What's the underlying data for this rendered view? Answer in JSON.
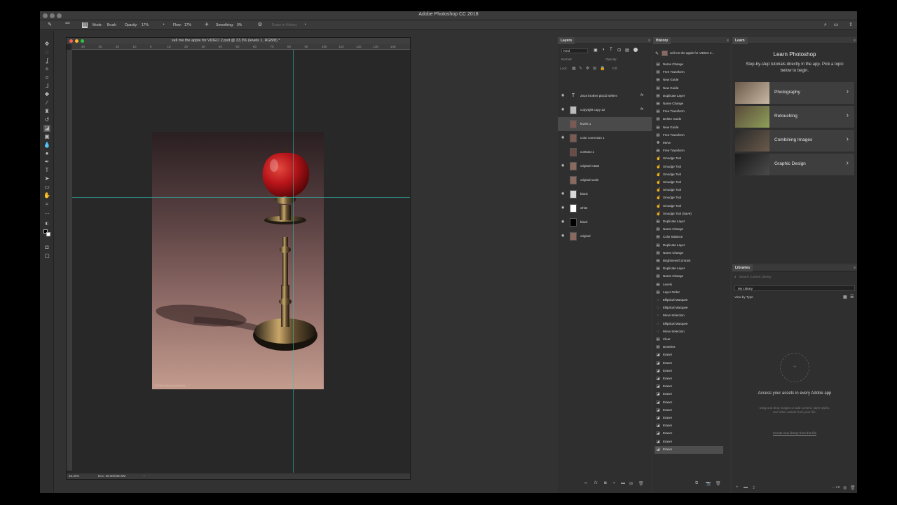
{
  "app": {
    "title": "Adobe Photoshop CC 2018"
  },
  "options_bar": {
    "brush_size": "380",
    "mode_label": "Mode:",
    "mode_value": "Brush",
    "opacity_label": "Opacity:",
    "opacity_value": "17%",
    "flow_label": "Flow:",
    "flow_value": "17%",
    "smoothing_label": "Smoothing:",
    "smoothing_value": "0%",
    "erase_history": "Erase to History"
  },
  "document": {
    "title": "sell me the apple for VIDEO 2.psd @ 33.3% (levels 1, RGB/8) *",
    "ruler_ticks": [
      "40",
      "30",
      "20",
      "10",
      "0",
      "10",
      "20",
      "30",
      "40",
      "50",
      "60",
      "70",
      "80",
      "90",
      "100",
      "110",
      "120",
      "130",
      "140"
    ],
    "zoom": "33.33%",
    "doc_size": "Doc: 39.0M/360.9M",
    "watermark": "©2018 brother placid sellers"
  },
  "layers": {
    "tab": "Layers",
    "filter_kind": "Kind",
    "blend_mode": "Normal",
    "opacity_label": "Opacity:",
    "lock_label": "Lock:",
    "fill_label": "Fill:",
    "items": [
      {
        "name": "2018 brother placid sellers",
        "type": "text",
        "fx": true,
        "visible": true,
        "selected": false,
        "thumb_color": "#2f2f2f"
      },
      {
        "name": "copyright copy 12",
        "type": "pixel",
        "fx": true,
        "visible": true,
        "selected": false,
        "thumb_color": "#bcbcbc"
      },
      {
        "name": "levels 1",
        "type": "pixel",
        "fx": false,
        "visible": false,
        "selected": true,
        "thumb_color": "#7a5a52"
      },
      {
        "name": "color correction 1",
        "type": "pixel",
        "fx": false,
        "visible": true,
        "selected": false,
        "thumb_color": "#7a5a52"
      },
      {
        "name": "contrast 1",
        "type": "pixel",
        "fx": false,
        "visible": false,
        "selected": false,
        "thumb_color": "#6a4c46"
      },
      {
        "name": "original rotate",
        "type": "pixel",
        "fx": false,
        "visible": true,
        "selected": false,
        "thumb_color": "#8a6a5e"
      },
      {
        "name": "original scale",
        "type": "pixel",
        "fx": false,
        "visible": false,
        "selected": false,
        "thumb_color": "#8a6a5e"
      },
      {
        "name": "blank",
        "type": "pixel",
        "fx": false,
        "visible": true,
        "selected": false,
        "thumb_color": "#d8d8d8"
      },
      {
        "name": "white",
        "type": "pixel",
        "fx": false,
        "visible": true,
        "selected": false,
        "thumb_color": "#ffffff"
      },
      {
        "name": "black",
        "type": "pixel",
        "fx": false,
        "visible": true,
        "selected": false,
        "thumb_color": "#000000"
      },
      {
        "name": "original",
        "type": "pixel",
        "fx": false,
        "visible": true,
        "selected": false,
        "thumb_color": "#8a6a5e"
      }
    ],
    "footer_icons": [
      "link-icon",
      "fx-icon",
      "mask-icon",
      "adjustment-icon",
      "group-icon",
      "new-layer-icon",
      "trash-icon"
    ]
  },
  "history": {
    "tab": "History",
    "source": "sell me the apple for VIDEO 2...",
    "items": [
      {
        "label": "Name Change",
        "icon": "doc"
      },
      {
        "label": "Free Transform",
        "icon": "doc"
      },
      {
        "label": "New Guide",
        "icon": "doc"
      },
      {
        "label": "New Guide",
        "icon": "doc"
      },
      {
        "label": "Duplicate Layer",
        "icon": "doc"
      },
      {
        "label": "Name Change",
        "icon": "doc"
      },
      {
        "label": "Free Transform",
        "icon": "doc"
      },
      {
        "label": "Delete Guide",
        "icon": "doc"
      },
      {
        "label": "New Guide",
        "icon": "doc"
      },
      {
        "label": "Free Transform",
        "icon": "doc"
      },
      {
        "label": "Move",
        "icon": "move"
      },
      {
        "label": "Free Transform",
        "icon": "doc"
      },
      {
        "label": "Smudge Tool",
        "icon": "smudge"
      },
      {
        "label": "Smudge Tool",
        "icon": "smudge"
      },
      {
        "label": "Smudge Tool",
        "icon": "smudge"
      },
      {
        "label": "Smudge Tool",
        "icon": "smudge"
      },
      {
        "label": "Smudge Tool",
        "icon": "smudge"
      },
      {
        "label": "Smudge Tool",
        "icon": "smudge"
      },
      {
        "label": "Smudge Tool",
        "icon": "smudge"
      },
      {
        "label": "Smudge Tool (Save)",
        "icon": "smudge"
      },
      {
        "label": "Duplicate Layer",
        "icon": "doc"
      },
      {
        "label": "Name Change",
        "icon": "doc"
      },
      {
        "label": "Color Balance",
        "icon": "doc"
      },
      {
        "label": "Duplicate Layer",
        "icon": "doc"
      },
      {
        "label": "Name Change",
        "icon": "doc"
      },
      {
        "label": "Brightness/Contrast",
        "icon": "doc"
      },
      {
        "label": "Duplicate Layer",
        "icon": "doc"
      },
      {
        "label": "Name Change",
        "icon": "doc"
      },
      {
        "label": "Levels",
        "icon": "doc"
      },
      {
        "label": "Layer Order",
        "icon": "doc"
      },
      {
        "label": "Elliptical Marquee",
        "icon": "ellipse"
      },
      {
        "label": "Elliptical Marquee",
        "icon": "ellipse"
      },
      {
        "label": "Move Selection",
        "icon": "ellipse"
      },
      {
        "label": "Elliptical Marquee",
        "icon": "ellipse"
      },
      {
        "label": "Move Selection",
        "icon": "ellipse"
      },
      {
        "label": "Clear",
        "icon": "doc"
      },
      {
        "label": "Deselect",
        "icon": "doc"
      },
      {
        "label": "Eraser",
        "icon": "eraser"
      },
      {
        "label": "Eraser",
        "icon": "eraser"
      },
      {
        "label": "Eraser",
        "icon": "eraser"
      },
      {
        "label": "Eraser",
        "icon": "eraser"
      },
      {
        "label": "Eraser",
        "icon": "eraser"
      },
      {
        "label": "Eraser",
        "icon": "eraser"
      },
      {
        "label": "Eraser",
        "icon": "eraser"
      },
      {
        "label": "Eraser",
        "icon": "eraser"
      },
      {
        "label": "Eraser",
        "icon": "eraser"
      },
      {
        "label": "Eraser",
        "icon": "eraser"
      },
      {
        "label": "Eraser",
        "icon": "eraser"
      },
      {
        "label": "Eraser",
        "icon": "eraser"
      },
      {
        "label": "Eraser",
        "icon": "eraser"
      }
    ]
  },
  "learn": {
    "tab": "Learn",
    "title": "Learn Photoshop",
    "description": "Step-by-step tutorials directly in the app. Pick a topic below to begin.",
    "topics": [
      {
        "label": "Photography",
        "thumb_colors": [
          "#6b5a4a",
          "#c9b8a3"
        ]
      },
      {
        "label": "Retouching",
        "thumb_colors": [
          "#5a4a3a",
          "#8fa05a"
        ]
      },
      {
        "label": "Combining Images",
        "thumb_colors": [
          "#2a2a2a",
          "#6a5a4a"
        ]
      },
      {
        "label": "Graphic Design",
        "thumb_colors": [
          "#1a1a1a",
          "#4a4a4a"
        ]
      }
    ]
  },
  "libraries": {
    "tab": "Libraries",
    "search_placeholder": "Search Current Library",
    "library": "My Library",
    "view_by": "View by Type",
    "access_text": "Access your assets in every Adobe app",
    "hint": "Drag and drop images or add content, layer styles, and other assets from your file.",
    "create_link": "Create new library from this file",
    "size": "— KB"
  },
  "colors": {
    "guide": "#2fc3b6",
    "panel_bg": "#2f2f2f",
    "app_bg": "#323232"
  }
}
